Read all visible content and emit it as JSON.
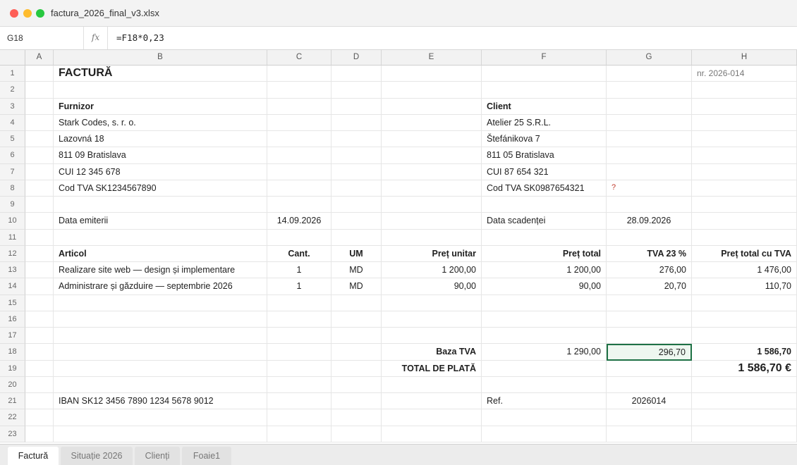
{
  "window": {
    "title": "factura_2026_final_v3.xlsx"
  },
  "formula_bar": {
    "cell_ref": "G18",
    "fx_label": "fx",
    "formula": "=F18*0,23"
  },
  "columns": [
    "A",
    "B",
    "C",
    "D",
    "E",
    "F",
    "G",
    "H"
  ],
  "rows": [
    {
      "num": "1",
      "cells": {
        "B": "FACTURĂ",
        "H": "nr. 2026-014"
      }
    },
    {
      "num": "2",
      "cells": {}
    },
    {
      "num": "3",
      "cells": {
        "B": "Furnizor",
        "F": "Client"
      }
    },
    {
      "num": "4",
      "cells": {
        "B": "Stark Codes, s. r. o.",
        "F": "Atelier 25 S.R.L."
      }
    },
    {
      "num": "5",
      "cells": {
        "B": "Lazovná 18",
        "F": "Štefánikova 7"
      }
    },
    {
      "num": "6",
      "cells": {
        "B": "811 09 Bratislava",
        "F": "811 05 Bratislava"
      }
    },
    {
      "num": "7",
      "cells": {
        "B": "CUI 12 345 678",
        "F": "CUI 87 654 321"
      }
    },
    {
      "num": "8",
      "cells": {
        "B": "Cod TVA SK1234567890",
        "F": "Cod TVA SK0987654321",
        "G": "?"
      }
    },
    {
      "num": "9",
      "cells": {}
    },
    {
      "num": "10",
      "cells": {
        "B": "Data emiterii",
        "C": "14.09.2026",
        "F": "Data scadenței",
        "G": "28.09.2026"
      }
    },
    {
      "num": "11",
      "cells": {}
    },
    {
      "num": "12",
      "cells": {
        "B": "Articol",
        "C": "Cant.",
        "D": "UM",
        "E": "Preț unitar",
        "F": "Preț total",
        "G": "TVA 23 %",
        "H": "Preț total cu TVA"
      }
    },
    {
      "num": "13",
      "cells": {
        "B": "Realizare site web — design și implementare",
        "C": "1",
        "D": "MD",
        "E": "1 200,00",
        "F": "1 200,00",
        "G": "276,00",
        "H": "1 476,00"
      }
    },
    {
      "num": "14",
      "cells": {
        "B": "Administrare și găzduire — septembrie 2026",
        "C": "1",
        "D": "MD",
        "E": "90,00",
        "F": "90,00",
        "G": "20,70",
        "H": "110,70"
      }
    },
    {
      "num": "15",
      "cells": {}
    },
    {
      "num": "16",
      "cells": {}
    },
    {
      "num": "17",
      "cells": {}
    },
    {
      "num": "18",
      "cells": {
        "E": "Baza TVA",
        "F": "1 290,00",
        "G": "296,70",
        "H": "1 586,70"
      }
    },
    {
      "num": "19",
      "cells": {
        "E": "TOTAL DE PLATĂ",
        "H": "1 586,70 €"
      }
    },
    {
      "num": "20",
      "cells": {}
    },
    {
      "num": "21",
      "cells": {
        "B": "IBAN SK12 3456 7890 1234 5678 9012",
        "F": "Ref.",
        "G": "2026014"
      }
    },
    {
      "num": "22",
      "cells": {}
    },
    {
      "num": "23",
      "cells": {}
    }
  ],
  "selected_cell": "G18",
  "sheet_tabs": [
    "Factură",
    "Situație 2026",
    "Clienți",
    "Foaie1"
  ],
  "active_tab": "Factură",
  "colors": {
    "selection": "#1e7145",
    "warning": "#c0392b"
  }
}
